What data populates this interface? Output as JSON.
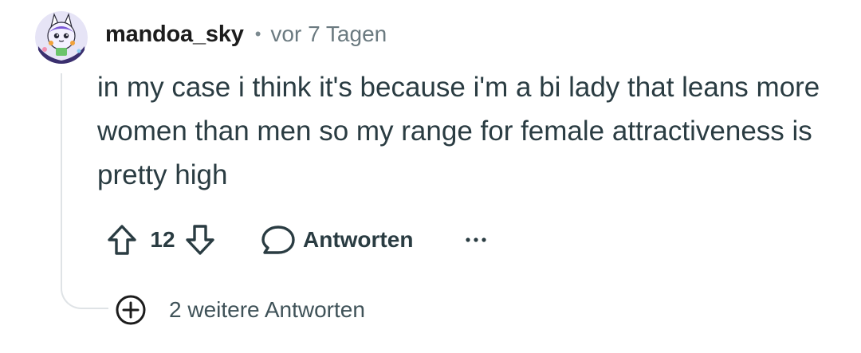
{
  "comment": {
    "username": "mandoa_sky",
    "separator": "•",
    "timestamp": "vor 7 Tagen",
    "body": "in my case i think it's because i'm a bi lady that leans more women than men so my range for female attractiveness is pretty high",
    "avatar_icon": "user-avatar"
  },
  "actions": {
    "upvote_icon": "arrow-up-icon",
    "vote_count": "12",
    "downvote_icon": "arrow-down-icon",
    "reply_icon": "speech-bubble-icon",
    "reply_label": "Antworten",
    "more_icon": "ellipsis-icon"
  },
  "more_replies": {
    "icon": "plus-circle-icon",
    "label": "2 weitere Antworten"
  },
  "colors": {
    "text": "#2a3c42",
    "username": "#1c1c1c",
    "muted": "#6b7a80",
    "thread_line": "#dfe3e6"
  }
}
